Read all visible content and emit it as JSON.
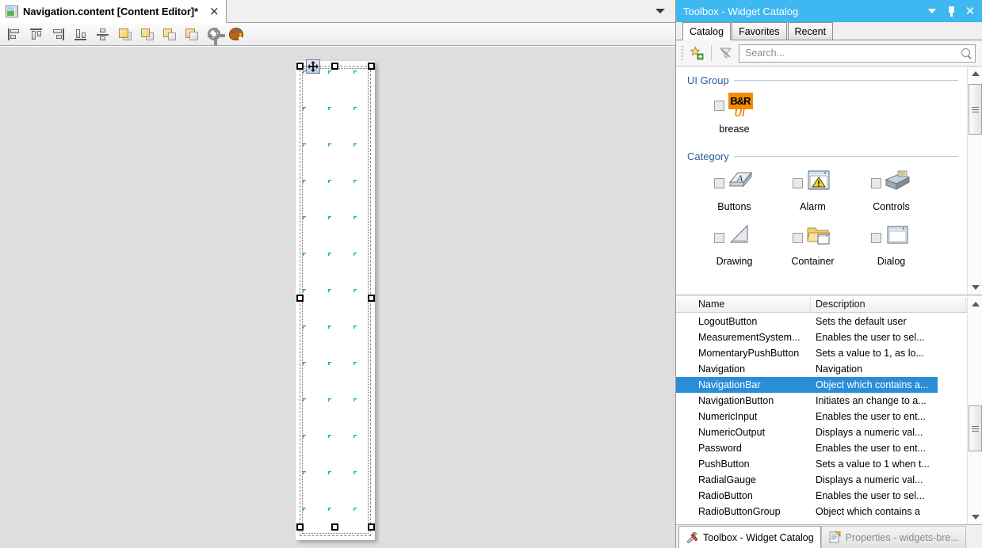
{
  "editor": {
    "tab": {
      "title": "Navigation.content [Content Editor]*",
      "close_label": "×",
      "icon": "content-editor-icon"
    },
    "tabstrip_dropdown_icon": "chevron-down-icon",
    "toolbar": [
      {
        "name": "align-left-button",
        "icon": "align-left-icon"
      },
      {
        "name": "align-top-button",
        "icon": "align-top-icon"
      },
      {
        "name": "align-right-button",
        "icon": "align-right-icon"
      },
      {
        "name": "align-bottom-button",
        "icon": "align-bottom-icon"
      },
      {
        "name": "align-center-vertical-button",
        "icon": "align-center-vertical-icon"
      },
      {
        "name": "bring-to-front-button",
        "icon": "bring-to-front-icon"
      },
      {
        "name": "bring-forward-button",
        "icon": "bring-forward-icon"
      },
      {
        "name": "send-backward-button",
        "icon": "send-backward-icon"
      },
      {
        "name": "send-to-back-button",
        "icon": "send-to-back-icon"
      },
      {
        "name": "settings-button",
        "icon": "gear-icon"
      },
      {
        "name": "theme-button",
        "icon": "palette-icon"
      }
    ],
    "canvas": {
      "selected_widget": "NavigationBar",
      "move_handle_icon": "move-cross-icon",
      "grid_color": "#19c64f",
      "page_background": "#ffffff",
      "canvas_background": "#dedede"
    }
  },
  "toolbox": {
    "title": "Toolbox - Widget Catalog",
    "title_bar_color": "#3fb7f0",
    "window_buttons": [
      {
        "name": "panel-menu-button",
        "icon": "chevron-down-icon"
      },
      {
        "name": "panel-pin-button",
        "icon": "pin-icon"
      },
      {
        "name": "panel-close-button",
        "icon": "close-icon"
      }
    ],
    "tabs": [
      {
        "label": "Catalog",
        "active": true
      },
      {
        "label": "Favorites",
        "active": false
      },
      {
        "label": "Recent",
        "active": false
      }
    ],
    "search": {
      "placeholder": "Search...",
      "value": "",
      "search_icon": "magnifier-icon",
      "add_favorite_icon": "star-add-icon",
      "clear_filter_icon": "filter-clear-icon"
    },
    "sections": [
      {
        "title": "UI Group",
        "items": [
          {
            "label": "brease",
            "icon": "br-ui-logo-icon",
            "checked": false
          }
        ]
      },
      {
        "title": "Category",
        "items": [
          {
            "label": "Buttons",
            "icon": "buttons-icon",
            "checked": false
          },
          {
            "label": "Alarm",
            "icon": "alarm-icon",
            "checked": false
          },
          {
            "label": "Controls",
            "icon": "controls-icon",
            "checked": false
          },
          {
            "label": "Drawing",
            "icon": "drawing-icon",
            "checked": false
          },
          {
            "label": "Container",
            "icon": "container-icon",
            "checked": false
          },
          {
            "label": "Dialog",
            "icon": "dialog-icon",
            "checked": false
          }
        ]
      }
    ],
    "list": {
      "columns": [
        "Name",
        "Description"
      ],
      "selected_row": "NavigationBar",
      "selection_color": "#2a8dd8",
      "rows": [
        {
          "name": "LogoutButton",
          "description": "Sets the default user",
          "selected": false
        },
        {
          "name": "MeasurementSystem...",
          "description": "Enables the user to sel...",
          "selected": false
        },
        {
          "name": "MomentaryPushButton",
          "description": "Sets a value to 1, as lo...",
          "selected": false
        },
        {
          "name": "Navigation",
          "description": "Navigation",
          "selected": false
        },
        {
          "name": "NavigationBar",
          "description": "Object which contains a...",
          "selected": true
        },
        {
          "name": "NavigationButton",
          "description": "Initiates an change to a...",
          "selected": false
        },
        {
          "name": "NumericInput",
          "description": "Enables the user to ent...",
          "selected": false
        },
        {
          "name": "NumericOutput",
          "description": "Displays a numeric val...",
          "selected": false
        },
        {
          "name": "Password",
          "description": "Enables the user to ent...",
          "selected": false
        },
        {
          "name": "PushButton",
          "description": "Sets a value to 1 when t...",
          "selected": false
        },
        {
          "name": "RadialGauge",
          "description": "Displays a numeric val...",
          "selected": false
        },
        {
          "name": "RadioButton",
          "description": "Enables the user to sel...",
          "selected": false
        },
        {
          "name": "RadioButtonGroup",
          "description": "Object which contains a",
          "selected": false
        }
      ]
    },
    "dock_tabs": [
      {
        "label": "Toolbox - Widget Catalog",
        "icon": "toolbox-icon",
        "active": true
      },
      {
        "label": "Properties - widgets-bre...",
        "icon": "properties-icon",
        "active": false
      }
    ]
  }
}
